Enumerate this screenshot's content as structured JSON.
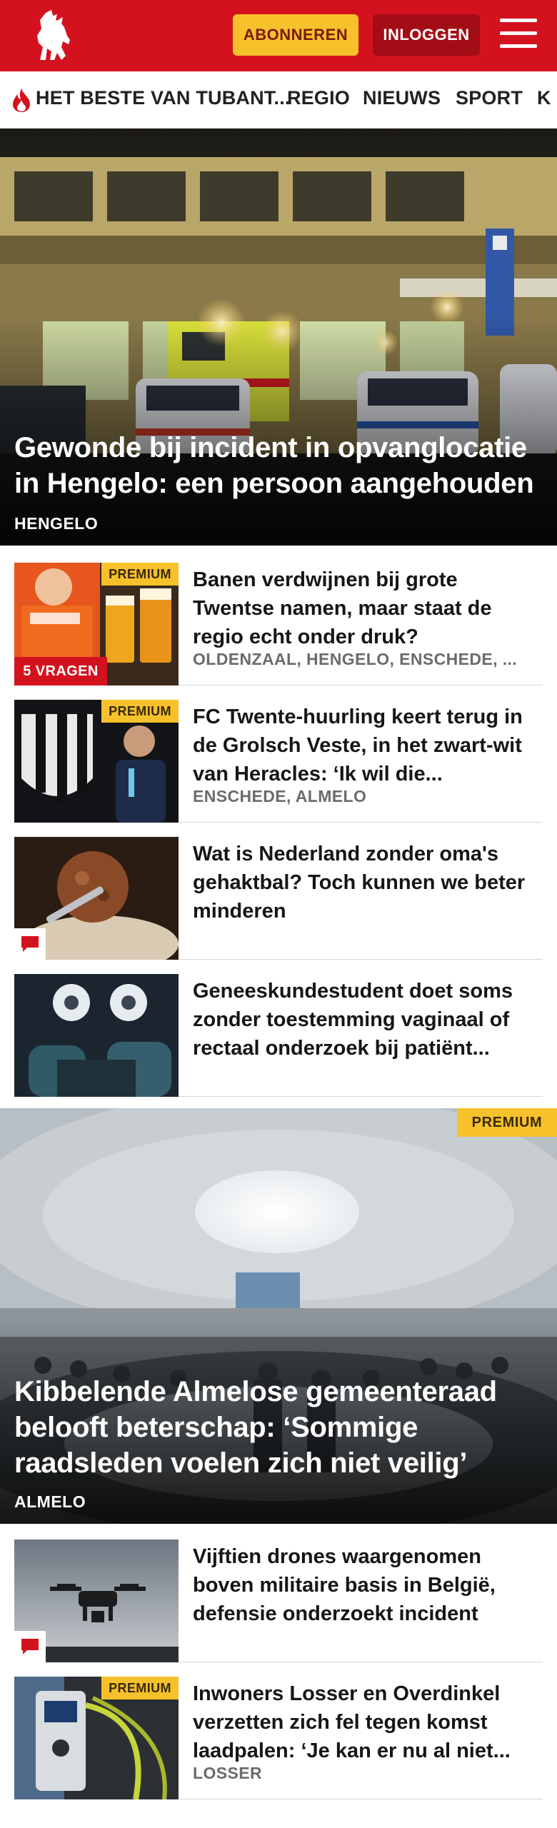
{
  "header": {
    "subscribe_label": "ABONNEREN",
    "login_label": "INLOGGEN",
    "brand_color": "#d4121e",
    "logo_icon": "twente-horse-logo",
    "menu_icon": "hamburger-menu-icon"
  },
  "nav": {
    "items": [
      "HET BESTE VAN TUBANT...",
      "REGIO",
      "NIEUWS",
      "SPORT",
      "K"
    ]
  },
  "hero1": {
    "title": "Gewonde bij incident in opvanglocatie in Hengelo: een persoon aangehouden",
    "location": "HENGELO"
  },
  "articles1": [
    {
      "title": "Banen verdwijnen bij grote Twentse namen, maar staat de regio echt onder druk?",
      "location": "OLDENZAAL, HENGELO, ENSCHEDE, ...",
      "premium": "PREMIUM",
      "tag": "5 VRAGEN"
    },
    {
      "title": "FC Twente-huurling keert terug in de Grolsch Veste, in het zwart-wit van Heracles: ‘Ik wil die...",
      "location": "ENSCHEDE, ALMELO",
      "premium": "PREMIUM"
    },
    {
      "title": "Wat is Nederland zonder oma's gehaktbal? Toch kunnen we beter minderen",
      "comment_icon": "comment-icon"
    },
    {
      "title": "Geneeskundestudent doet soms zonder toestemming vaginaal of rectaal onderzoek bij patiënt..."
    }
  ],
  "hero2": {
    "premium": "PREMIUM",
    "title": "Kibbelende Almelose gemeenteraad belooft beterschap: ‘Sommige raadsleden voelen zich niet veilig’",
    "location": "ALMELO"
  },
  "articles2": [
    {
      "title": "Vijftien drones waargenomen boven militaire basis in België, defensie onderzoekt incident",
      "comment_icon": "comment-icon"
    },
    {
      "title": "Inwoners Losser en Overdinkel verzetten zich fel tegen komst laadpalen: ‘Je kan er nu al niet...",
      "location": "LOSSER",
      "premium": "PREMIUM"
    }
  ]
}
